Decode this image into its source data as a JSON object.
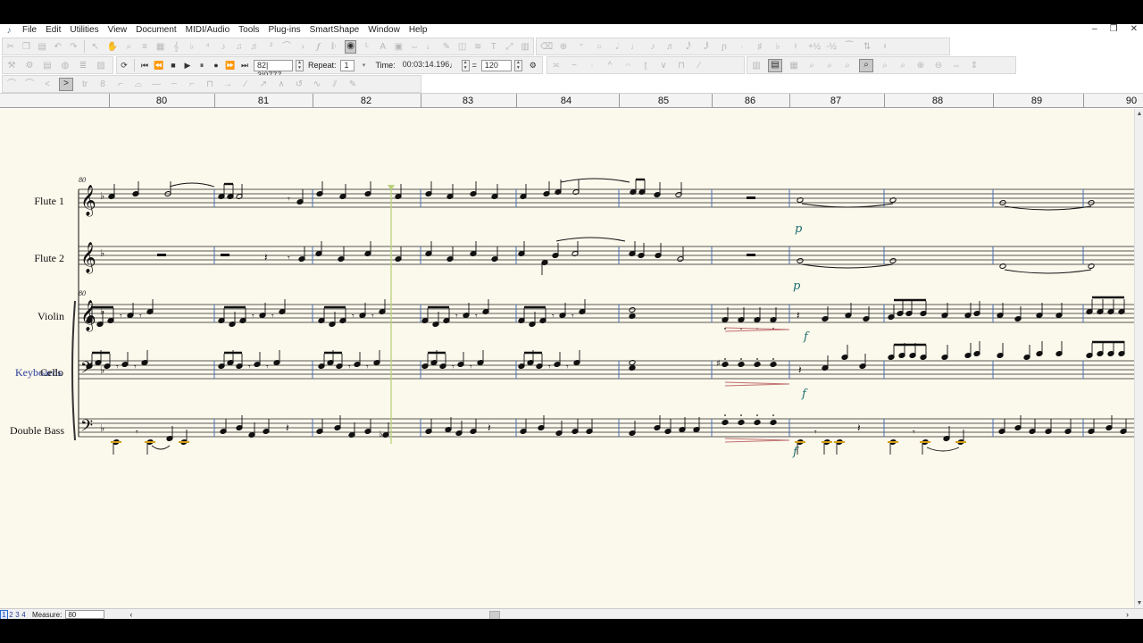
{
  "menu": {
    "items": [
      "File",
      "Edit",
      "Utilities",
      "View",
      "Document",
      "MIDI/Audio",
      "Tools",
      "Plug-ins",
      "SmartShape",
      "Window",
      "Help"
    ],
    "minimize": "–",
    "restore": "❐",
    "close": "✕"
  },
  "playback": {
    "position": "82| 3|0777",
    "repeat_label": "Repeat:",
    "repeat_value": "1",
    "time_label": "Time:",
    "time_value": "00:03:14.196",
    "tempo_eq": "=",
    "tempo_value": "120"
  },
  "ruler": {
    "measures": [
      "80",
      "81",
      "82",
      "83",
      "84",
      "85",
      "86",
      "87",
      "88",
      "89",
      "90"
    ]
  },
  "score": {
    "instruments": [
      "Flute 1",
      "Flute 2",
      "Violin",
      "Keyboards",
      "Cello",
      "Double Bass"
    ],
    "system_measure_number": "80",
    "dynamics": {
      "p": "p",
      "f": "f"
    }
  },
  "status": {
    "pages": [
      "1",
      "2",
      "3",
      "4"
    ],
    "measure_label": "Measure:",
    "measure_value": "80",
    "scroll_left": "‹",
    "scroll_right": "›"
  },
  "colors": {
    "barline_highlight": "#4a6fb5",
    "playback_cursor": "#b8d27a",
    "dynamics": "#1f6e6e",
    "hairpin": "#c07070",
    "keyboards_label": "#2a3c99",
    "page_background": "#fbf8ec"
  }
}
